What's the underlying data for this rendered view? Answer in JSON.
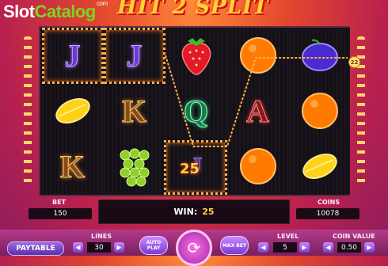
{
  "brand": {
    "slot": "Slot",
    "catalog": "Catalog",
    "com": "com"
  },
  "game_title": "HIT 2 SPLIT",
  "reels": [
    [
      "J",
      "lemon",
      "K"
    ],
    [
      "J",
      "K",
      "grapes"
    ],
    [
      "strawberry",
      "Q",
      "25"
    ],
    [
      "orange",
      "A",
      "orange"
    ],
    [
      "plum",
      "orange",
      "lemon"
    ]
  ],
  "win_badge": "25",
  "line_number": "22",
  "bet": {
    "label": "BET",
    "value": "150"
  },
  "win": {
    "label": "WIN:",
    "value": "25"
  },
  "coins": {
    "label": "COINS",
    "value": "10078"
  },
  "lines": {
    "label": "LINES",
    "value": "30"
  },
  "level": {
    "label": "LEVEL",
    "value": "5"
  },
  "coin_value": {
    "label": "COIN VALUE",
    "value": "0.50"
  },
  "buttons": {
    "paytable": "PAYTABLE",
    "autoplay": "AUTO PLAY",
    "maxbet": "MAX BET",
    "arrow_left": "◀",
    "arrow_right": "▶",
    "spin": "⟳"
  }
}
